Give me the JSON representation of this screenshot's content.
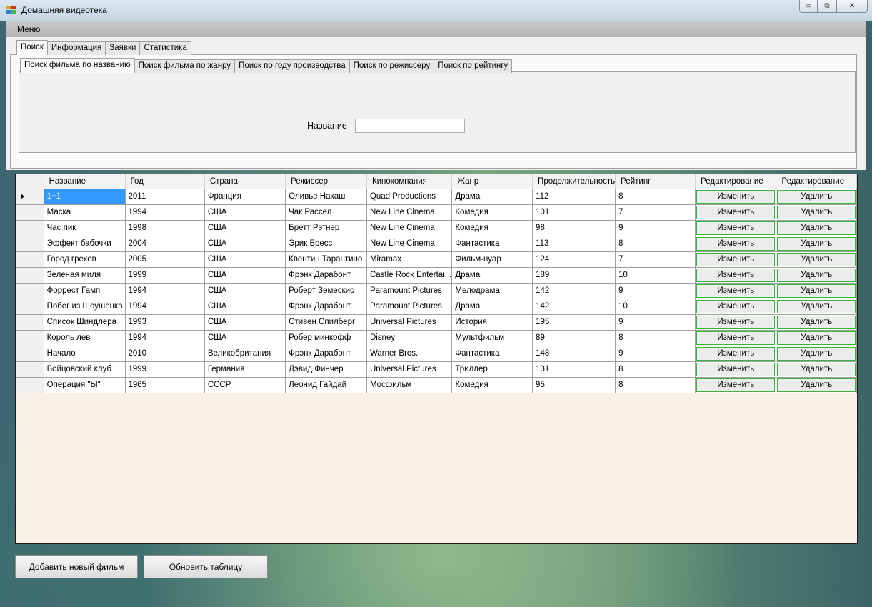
{
  "window": {
    "title": "Домашняя видеотека",
    "controls": [
      "▭",
      "⧉",
      "✕"
    ]
  },
  "menu": {
    "items": [
      "Меню"
    ]
  },
  "main_tabs": [
    "Поиск",
    "Информация",
    "Заявки",
    "Статистика"
  ],
  "search_tabs": [
    "Поиск фильма по названию",
    "Поиск фильма по жанру",
    "Поиск по году производства",
    "Поиск по режиссеру",
    "Поиск по рейтингу"
  ],
  "search": {
    "label": "Название",
    "value": ""
  },
  "table": {
    "columns": [
      "Название",
      "Год",
      "Страна",
      "Режиссер",
      "Кинокомпания",
      "Жанр",
      "Продолжительность",
      "Рейтинг",
      "Редактирование",
      "Редактирование"
    ],
    "edit_label": "Изменить",
    "delete_label": "Удалить",
    "rows": [
      [
        "1+1",
        "2011",
        "Франция",
        "Оливье Накаш",
        "Quad Productions",
        "Драма",
        "112",
        "8"
      ],
      [
        "Маска",
        "1994",
        "США",
        "Чак Рассел",
        "New Line Cinema",
        "Комедия",
        "101",
        "7"
      ],
      [
        "Час пик",
        "1998",
        "США",
        "Бретт Рэтнер",
        "New Line Cinema",
        "Комедия",
        "98",
        "9"
      ],
      [
        "Эффект бабочки",
        "2004",
        "США",
        "Эрик Бресс",
        "New Line Cinema",
        "Фантастика",
        "113",
        "8"
      ],
      [
        "Город грехов",
        "2005",
        "США",
        "Квентин Тарантино",
        "Miramax",
        "Фильм-нуар",
        "124",
        "7"
      ],
      [
        "Зеленая миля",
        "1999",
        "США",
        "Фрэнк Дарабонт",
        "Castle Rock Entertai...",
        "Драма",
        "189",
        "10"
      ],
      [
        "Форрест Гамп",
        "1994",
        "США",
        "Роберт Земескис",
        "Paramount Pictures",
        "Мелодрама",
        "142",
        "9"
      ],
      [
        "Побег из Шоушенка",
        "1994",
        "США",
        "Фрэнк Дарабонт",
        "Paramount Pictures",
        "Драма",
        "142",
        "10"
      ],
      [
        "Список Шиндлера",
        "1993",
        "США",
        "Стивен Спилберг",
        "Universal Pictures",
        "История",
        "195",
        "9"
      ],
      [
        "Король лев",
        "1994",
        "США",
        "Робер минкофф",
        "Disney",
        "Мультфильм",
        "89",
        "8"
      ],
      [
        "Начало",
        "2010",
        "Великобритания",
        "Фрэнк Дарабонт",
        "Warner Bros.",
        "Фантастика",
        "148",
        "9"
      ],
      [
        "Бойцовский клуб",
        "1999",
        "Германия",
        "Дэвид Финчер",
        "Universal Pictures",
        "Триллер",
        "131",
        "8"
      ],
      [
        "Операция \"Ы\"",
        "1965",
        "СССР",
        "Леонид Гайдай",
        "Мосфильм",
        "Комедия",
        "95",
        "8"
      ]
    ]
  },
  "buttons": {
    "add": "Добавить новый фильм",
    "refresh": "Обновить таблицу"
  }
}
